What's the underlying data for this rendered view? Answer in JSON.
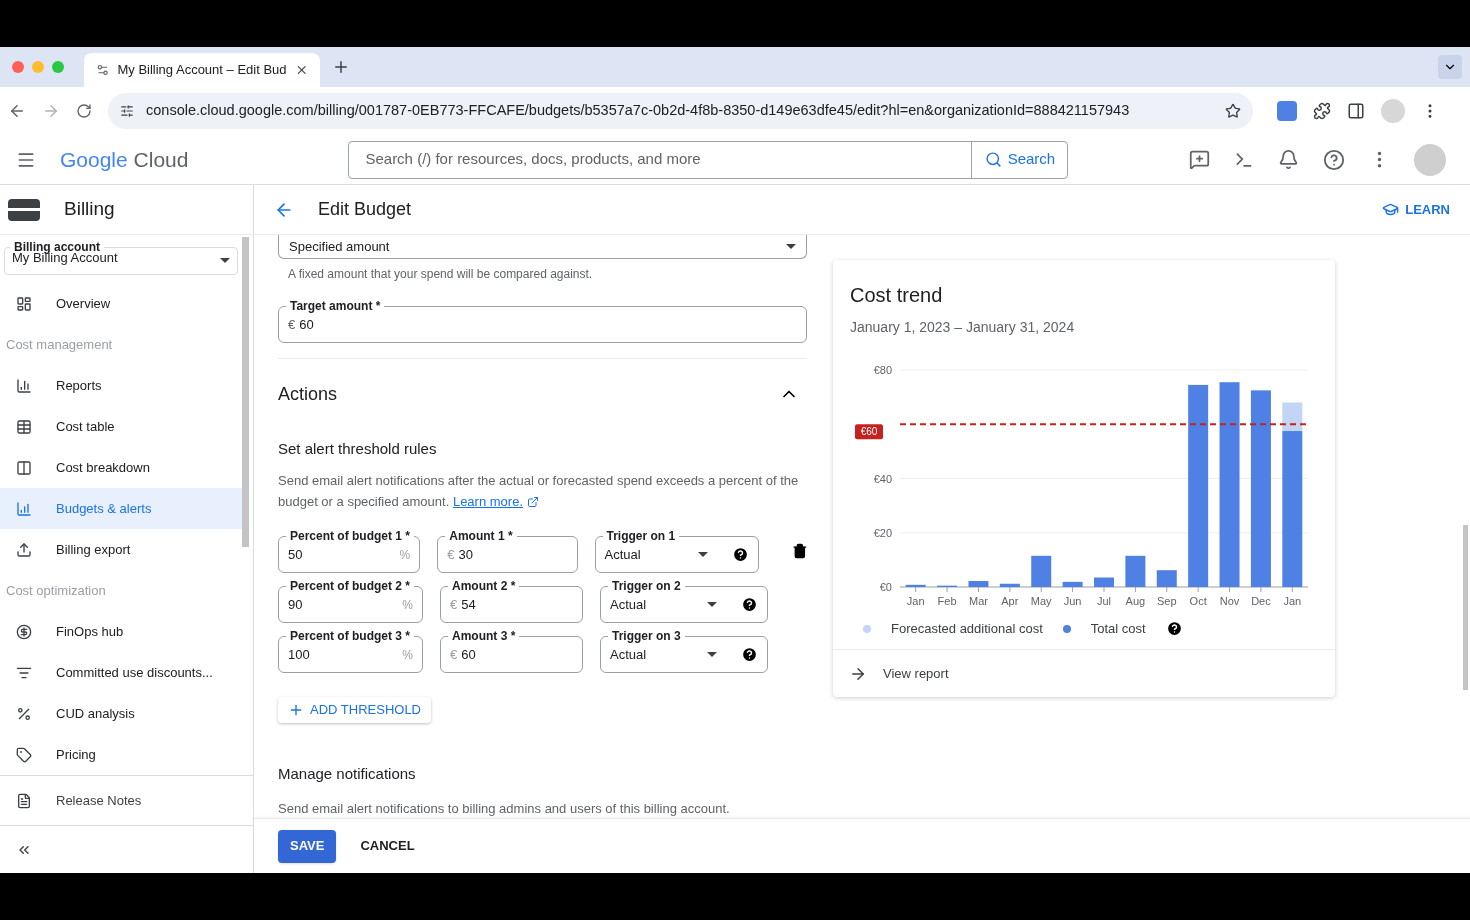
{
  "browser": {
    "tab_title": "My Billing Account – Edit Bud",
    "url": "console.cloud.google.com/billing/001787-0EB773-FFCAFE/budgets/b5357a7c-0b2d-4f8b-8350-d149e63dfe45/edit?hl=en&organizationId=888421157943"
  },
  "header": {
    "logo_google": "Google",
    "logo_cloud": "Cloud",
    "search_placeholder": "Search (/) for resources, docs, products, and more",
    "search_button": "Search"
  },
  "sidebar": {
    "title": "Billing",
    "account_label": "Billing account",
    "account_value": "My Billing Account",
    "sections": [
      {
        "items": [
          {
            "label": "Overview",
            "selected": false
          }
        ]
      },
      {
        "heading": "Cost management",
        "items": [
          {
            "label": "Reports",
            "selected": false
          },
          {
            "label": "Cost table",
            "selected": false
          },
          {
            "label": "Cost breakdown",
            "selected": false
          },
          {
            "label": "Budgets & alerts",
            "selected": true
          },
          {
            "label": "Billing export",
            "selected": false
          }
        ]
      },
      {
        "heading": "Cost optimization",
        "items": [
          {
            "label": "FinOps hub",
            "selected": false
          },
          {
            "label": "Committed use discounts...",
            "selected": false
          },
          {
            "label": "CUD analysis",
            "selected": false
          },
          {
            "label": "Pricing",
            "selected": false
          }
        ]
      }
    ],
    "release_notes": "Release Notes"
  },
  "page": {
    "title": "Edit Budget",
    "learn": "LEARN"
  },
  "form": {
    "amount_type": {
      "value": "Specified amount",
      "helper": "A fixed amount that your spend will be compared against."
    },
    "target": {
      "label": "Target amount *",
      "prefix": "€",
      "value": "60"
    },
    "actions": {
      "title": "Actions",
      "expanded": true
    },
    "threshold_title": "Set alert threshold rules",
    "threshold_desc": "Send email alert notifications after the actual or forecasted spend exceeds a percent of the budget or a specified amount.",
    "learn_more": "Learn more.",
    "thresholds": [
      {
        "percent_label": "Percent of budget 1 *",
        "percent": "50",
        "percent_suffix": "%",
        "amount_label": "Amount 1 *",
        "amount_prefix": "€",
        "amount": "30",
        "trigger_label": "Trigger on 1",
        "trigger": "Actual"
      },
      {
        "percent_label": "Percent of budget 2 *",
        "percent": "90",
        "percent_suffix": "%",
        "amount_label": "Amount 2 *",
        "amount_prefix": "€",
        "amount": "54",
        "trigger_label": "Trigger on 2",
        "trigger": "Actual"
      },
      {
        "percent_label": "Percent of budget 3 *",
        "percent": "100",
        "percent_suffix": "%",
        "amount_label": "Amount 3 *",
        "amount_prefix": "€",
        "amount": "60",
        "trigger_label": "Trigger on 3",
        "trigger": "Actual"
      }
    ],
    "add_threshold": "ADD THRESHOLD",
    "notifications_title": "Manage notifications",
    "notifications_desc": "Send email alert notifications to billing admins and users of this billing account.",
    "save": "SAVE",
    "cancel": "CANCEL"
  },
  "cost_trend": {
    "title": "Cost trend",
    "subtitle": "January 1, 2023 – January 31, 2024",
    "chart_data": {
      "type": "bar",
      "stacked": true,
      "categories": [
        "Jan",
        "Feb",
        "Mar",
        "Apr",
        "May",
        "Jun",
        "Jul",
        "Aug",
        "Sep",
        "Oct",
        "Nov",
        "Dec",
        "Jan"
      ],
      "series": [
        {
          "name": "Total cost",
          "color": "#4f81e5",
          "values": [
            0.8,
            0.5,
            2.2,
            1.2,
            11.5,
            1.9,
            3.5,
            11.5,
            6.2,
            74.5,
            75.5,
            72.5,
            57.5
          ]
        },
        {
          "name": "Forecasted additional cost",
          "color": "#c3d5f5",
          "values": [
            null,
            null,
            null,
            null,
            null,
            null,
            null,
            null,
            null,
            null,
            null,
            null,
            10.5
          ]
        }
      ],
      "ylim": [
        0,
        80
      ],
      "yticks": [
        {
          "value": 0,
          "label": "€0"
        },
        {
          "value": 20,
          "label": "€20"
        },
        {
          "value": 40,
          "label": "€40"
        },
        {
          "value": 80,
          "label": "€80"
        }
      ],
      "ref_lines": [
        {
          "axis": "y",
          "value": 60,
          "label": "€60",
          "color": "#c5221f"
        }
      ]
    },
    "view_report": "View report"
  }
}
